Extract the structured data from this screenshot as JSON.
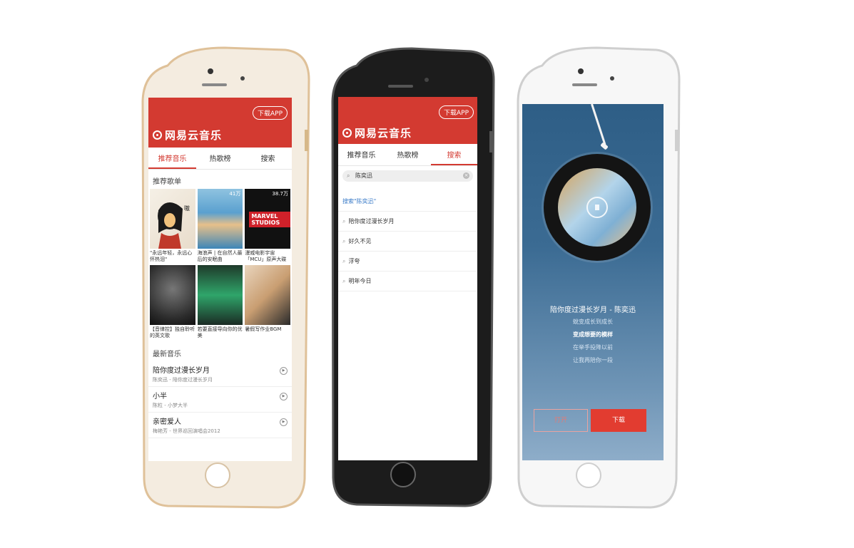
{
  "app": {
    "name": "网易云音乐",
    "download_app": "下载APP",
    "tabs": [
      "推荐音乐",
      "热歌榜",
      "搜索"
    ]
  },
  "phone1": {
    "section_playlists": "推荐歌单",
    "playlists": [
      {
        "count": "",
        "text": "\"永远年轻，永远心怀热泪\""
      },
      {
        "count": "41万",
        "text": "海浪声 | 在自然人最后的安眠曲"
      },
      {
        "count": "38.7万",
        "text": "漫威电影宇宙「MCU」原声大碟"
      },
      {
        "count": "",
        "text": "【音律控】独自聆听的英文歌"
      },
      {
        "count": "",
        "text": "若要直接导向你的优美"
      },
      {
        "count": "",
        "text": "暑假写作业BGM"
      }
    ],
    "marvel_text": "MARVEL STUDIOS",
    "section_new": "最新音乐",
    "songs": [
      {
        "title": "陪你度过漫长岁月",
        "sub": "陈奕迅 - 陪你度过漫长岁月"
      },
      {
        "title": "小半",
        "sub": "陈粒 - 小梦大半"
      },
      {
        "title": "亲密爱人",
        "sub": "梅艳芳 - 世界巡回演唱会2012"
      }
    ]
  },
  "phone2": {
    "search_value": "陈奕迅",
    "search_line": "搜索\"陈奕迅\"",
    "suggestions": [
      "陪你度过漫长岁月",
      "好久不见",
      "浮夸",
      "明年今日"
    ]
  },
  "phone3": {
    "song_title": "陪你度过漫长岁月 - 陈奕迅",
    "lyrics": [
      "蛻变成长到成长",
      "变成想要的模样",
      "在举手投降以前",
      "让我再陪你一段"
    ],
    "open_label": "打开",
    "download_label": "下载"
  },
  "colors": {
    "brand": "#d33a31",
    "gold_frame": "#e3c8a0",
    "dark_frame": "#2a2a2a",
    "silver_frame": "#dcdcdc"
  }
}
